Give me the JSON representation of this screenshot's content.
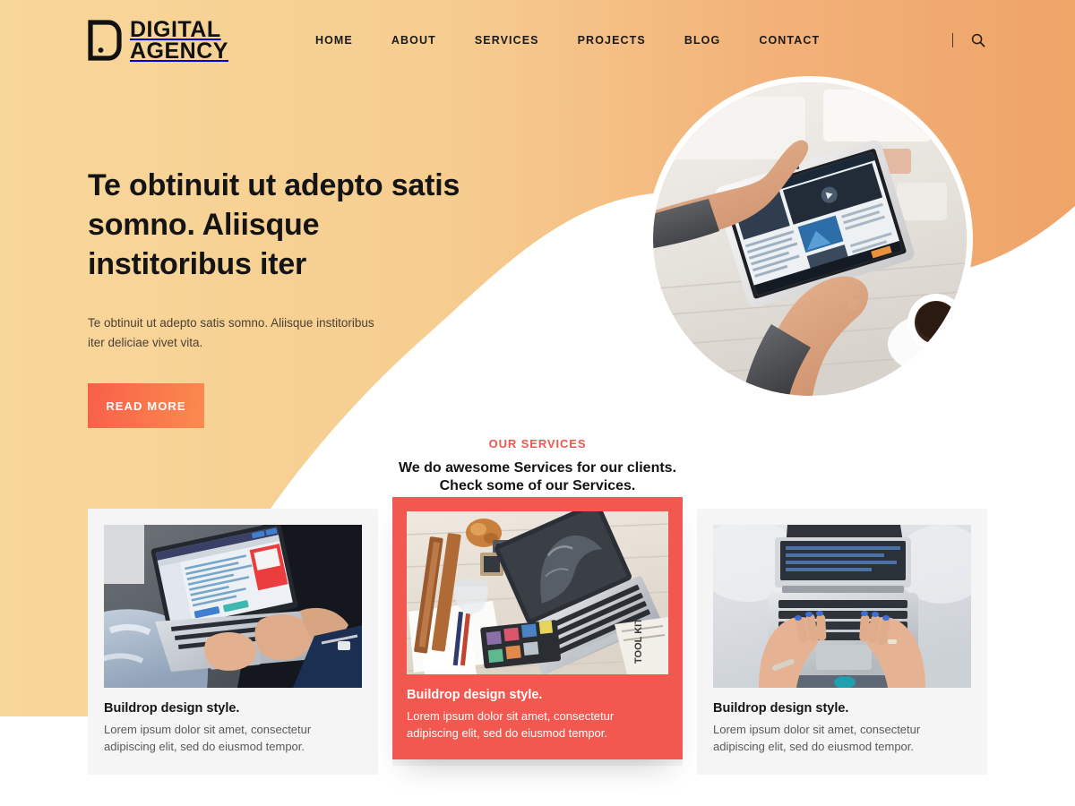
{
  "brand": {
    "logo_icon": "door-tablet-logo-icon",
    "line1": "DIGITAL",
    "line2": "AGENCY"
  },
  "nav": {
    "items": [
      {
        "label": "HOME"
      },
      {
        "label": "ABOUT"
      },
      {
        "label": "SERVICES"
      },
      {
        "label": "PROJECTS"
      },
      {
        "label": "BLOG"
      },
      {
        "label": "CONTACT"
      }
    ],
    "divider": "|",
    "search_icon": "search-icon"
  },
  "hero": {
    "title": "Te obtinuit ut adepto satis somno. Aliisque institoribus iter",
    "subtitle": "Te obtinuit ut adepto satis somno. Aliisque institoribus iter deliciae vivet vita.",
    "cta_label": "READ MORE",
    "image_alt": "hands-using-tablet-with-coffee-photo"
  },
  "services": {
    "eyebrow": "OUR SERVICES",
    "heading_line1": "We do awesome Services for our clients.",
    "heading_line2": "Check some of our Services.",
    "cards": [
      {
        "title": "Buildrop design style.",
        "body": "Lorem ipsum dolor sit amet, consectetur adipiscing elit, sed do eiusmod tempor.",
        "image_alt": "man-on-laptop-in-jeans-photo",
        "featured": false
      },
      {
        "title": "Buildrop design style.",
        "body": "Lorem ipsum dolor sit amet, consectetur adipiscing elit, sed do eiusmod tempor.",
        "image_alt": "desk-flatlay-laptop-tools-photo",
        "featured": true
      },
      {
        "title": "Buildrop design style.",
        "body": "Lorem ipsum dolor sit amet, consectetur adipiscing elit, sed do eiusmod tempor.",
        "image_alt": "hands-typing-on-macbook-overhead-photo",
        "featured": false
      }
    ]
  },
  "colors": {
    "bg_left": "#f8d79b",
    "bg_right": "#f0a86a",
    "accent_red": "#f2584f",
    "accent_eyebrow": "#f0574c",
    "button_from": "#f85f4a",
    "button_to": "#fb8b4e",
    "card_bg": "#f5f5f5",
    "text_dark": "#141414",
    "page_bg": "#ffffff"
  }
}
